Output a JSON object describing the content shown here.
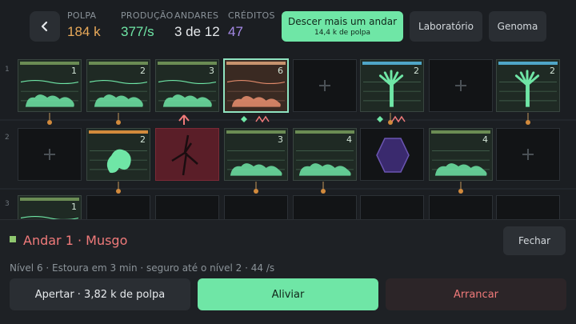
{
  "header": {
    "back_icon": "chevron-left-icon",
    "stats": [
      {
        "label": "POLPA",
        "value": "184 k",
        "color": "#e8a95a"
      },
      {
        "label": "PRODUÇÃO",
        "value": "377/s",
        "color": "#6fe6a6"
      },
      {
        "label": "ANDARES",
        "value": "3 de 12",
        "color": "#e6e9ec"
      },
      {
        "label": "CRÉDITOS",
        "value": "47",
        "color": "#a58ae6"
      }
    ],
    "descend_label": "Descer mais um andar",
    "descend_cost": "14,4 k de polpa",
    "lab_label": "Laboratório",
    "genome_label": "Genoma"
  },
  "grid": {
    "row_labels": [
      "1",
      "2",
      "3"
    ],
    "row1_numbers": [
      "1",
      "2",
      "3",
      "6",
      "2",
      "2"
    ],
    "row2_numbers": [
      "2",
      "3",
      "4",
      "4"
    ],
    "row3_numbers": [
      "1"
    ]
  },
  "panel": {
    "title": "Andar 1 · Musgo",
    "close_label": "Fechar",
    "info": "Nível 6  ·  Estoura em 3 min  ·  seguro até o nível 2  ·  44 /s",
    "squeeze_label": "Apertar · 3,82 k de polpa",
    "relieve_label": "Aliviar",
    "pull_label": "Arrancar"
  },
  "colors": {
    "accent": "#6fe6a6",
    "danger": "#f07a7a",
    "background": "#1a1d21"
  }
}
